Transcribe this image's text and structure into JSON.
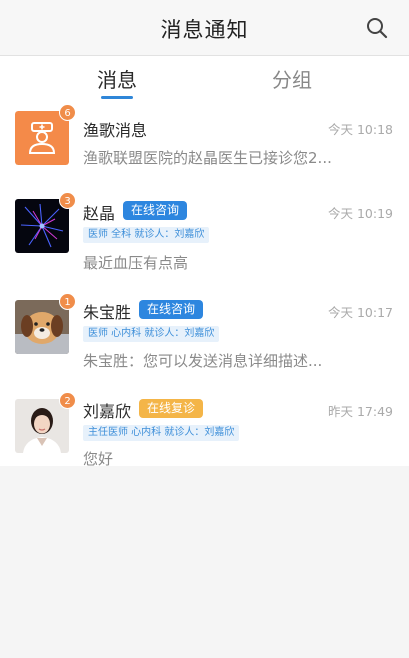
{
  "header": {
    "title": "消息通知",
    "search_icon": "search-icon"
  },
  "tabs": [
    {
      "label": "消息",
      "active": true
    },
    {
      "label": "分组",
      "active": false
    }
  ],
  "colors": {
    "accent": "#2f86d8",
    "badge": "#f08d4a",
    "tag_blue": "#2d86df",
    "tag_orange": "#f4b548"
  },
  "conversations": [
    {
      "name": "渔歌消息",
      "badge": "6",
      "time": "今天 10:18",
      "preview": "渔歌联盟医院的赵晶医生已接诊您2...",
      "avatar_icon": "nurse-icon"
    },
    {
      "name": "赵晶",
      "badge": "3",
      "tag": "在线咨询",
      "time": "今天 10:19",
      "info": "医师  全科  就诊人：刘嘉欣",
      "preview": "最近血压有点高",
      "avatar_icon": "starburst-avatar"
    },
    {
      "name": "朱宝胜",
      "badge": "1",
      "tag": "在线咨询",
      "time": "今天 10:17",
      "info": "医师  心内科  就诊人：刘嘉欣",
      "preview": "朱宝胜：您可以发送消息详细描述...",
      "avatar_icon": "dog-avatar"
    },
    {
      "name": "刘嘉欣",
      "badge": "2",
      "tag": "在线复诊",
      "time": "昨天 17:49",
      "info": "主任医师  心内科  就诊人：刘嘉欣",
      "preview": "您好",
      "avatar_icon": "doctor-avatar"
    }
  ]
}
